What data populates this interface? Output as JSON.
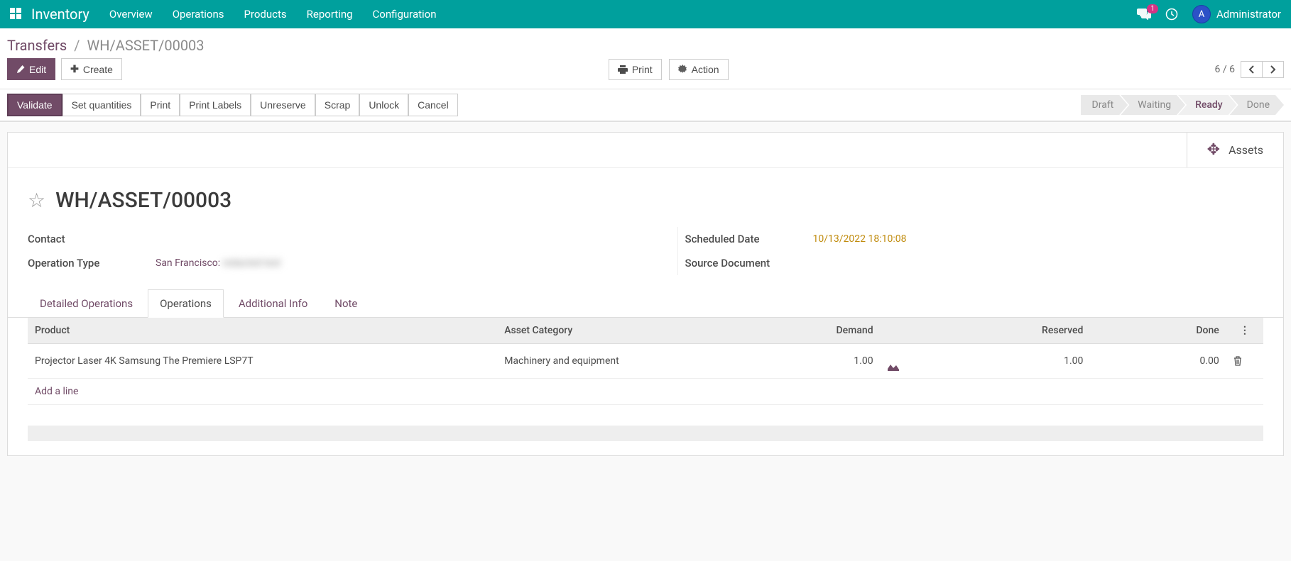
{
  "nav": {
    "brand": "Inventory",
    "items": [
      "Overview",
      "Operations",
      "Products",
      "Reporting",
      "Configuration"
    ],
    "messages_badge": "1",
    "user_initial": "A",
    "user_name": "Administrator"
  },
  "breadcrumb": {
    "parent": "Transfers",
    "current": "WH/ASSET/00003"
  },
  "toolbar": {
    "edit": "Edit",
    "create": "Create",
    "print": "Print",
    "action": "Action",
    "pager": "6 / 6"
  },
  "statusbar": {
    "actions": [
      "Validate",
      "Set quantities",
      "Print",
      "Print Labels",
      "Unreserve",
      "Scrap",
      "Unlock",
      "Cancel"
    ],
    "steps": [
      "Draft",
      "Waiting",
      "Ready",
      "Done"
    ],
    "active_step": 2
  },
  "smart": {
    "assets": "Assets"
  },
  "record": {
    "title": "WH/ASSET/00003",
    "contact_label": "Contact",
    "operation_type_label": "Operation Type",
    "operation_type_value": "San Francisco:",
    "operation_type_blur": "redacted text",
    "scheduled_date_label": "Scheduled Date",
    "scheduled_date_value": "10/13/2022 18:10:08",
    "source_doc_label": "Source Document"
  },
  "tabs": [
    "Detailed Operations",
    "Operations",
    "Additional Info",
    "Note"
  ],
  "active_tab": 1,
  "table": {
    "headers": {
      "product": "Product",
      "asset_cat": "Asset Category",
      "demand": "Demand",
      "reserved": "Reserved",
      "done": "Done"
    },
    "rows": [
      {
        "product": "Projector Laser 4K Samsung The Premiere LSP7T",
        "asset_cat": "Machinery and equipment",
        "demand": "1.00",
        "reserved": "1.00",
        "done": "0.00"
      }
    ],
    "add_line": "Add a line"
  }
}
